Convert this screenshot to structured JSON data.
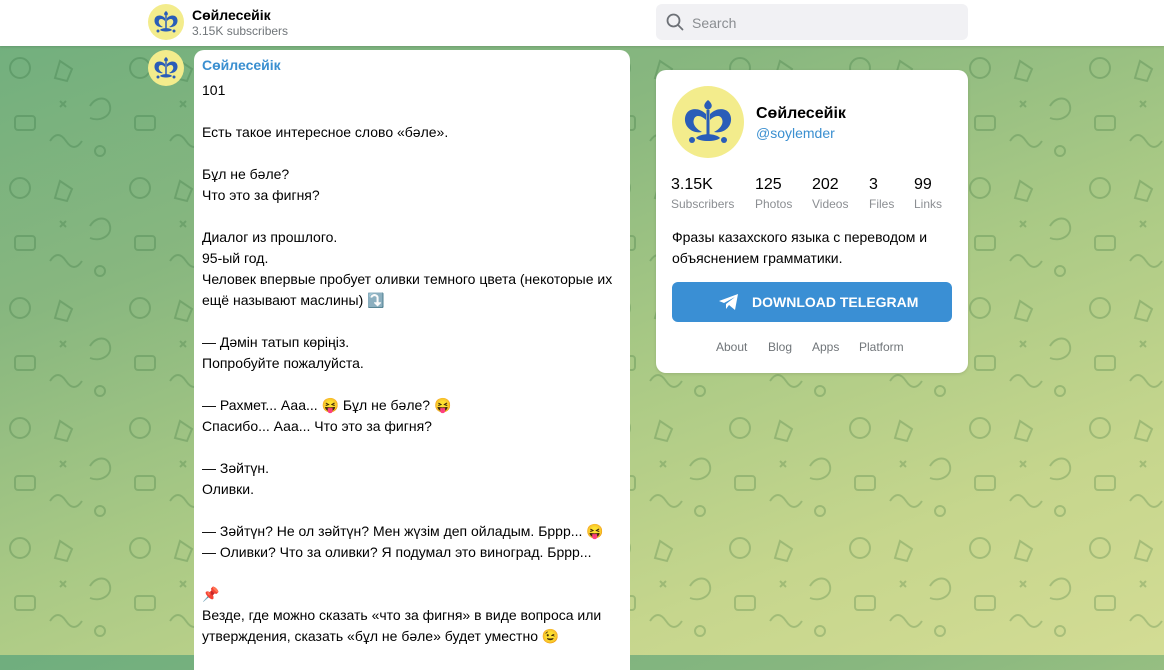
{
  "header": {
    "channel_name": "Сөйлесейік",
    "subscribers": "3.15K subscribers",
    "search_placeholder": "Search"
  },
  "post": {
    "author": "Сөйлесейік",
    "text": "101\n\nЕсть такое интересное слово «бәле».\n\nБұл не бәле?\nЧто это за фигня?\n\nДиалог из прошлого.\n95-ый год.\nЧеловек впервые пробует оливки темного цвета (некоторые их ещё называют маслины) ⤵️\n\n— Дәмін татып көріңіз.\nПопробуйте пожалуйста.\n\n— Рахмет... Ааа... 😝 Бұл не бәле? 😝\nСпасибо... Ааа... Что это за фигня?\n\n— Зәйтүн.\nОливки.\n\n— Зәйтүн? Не ол зәйтүн? Мен жүзім деп ойладым. Бррр... 😝\n— Оливки? Что за оливки? Я подумал это виноград. Бррр...\n\n📌\nВезде, где можно сказать «что за фигня» в виде вопроса или утверждения, сказать «бұл не бәле» будет уместно 😉"
  },
  "card": {
    "title": "Сөйлесейік",
    "handle": "@soylemder",
    "stats": [
      {
        "value": "3.15K",
        "label": "Subscribers"
      },
      {
        "value": "125",
        "label": "Photos"
      },
      {
        "value": "202",
        "label": "Videos"
      },
      {
        "value": "3",
        "label": "Files"
      },
      {
        "value": "99",
        "label": "Links"
      }
    ],
    "description": "Фразы казахского языка с переводом и объяснением грамматики.",
    "download_label": "DOWNLOAD TELEGRAM",
    "links": [
      "About",
      "Blog",
      "Apps",
      "Platform"
    ]
  },
  "colors": {
    "accent": "#3a8fd4",
    "link": "#3a8fd0",
    "avatar_bg": "#f3ec8c",
    "logo_blue": "#2a5db8"
  },
  "icons": {
    "search": "search-icon",
    "telegram": "telegram-plane-icon",
    "avatar": "channel-logo-icon"
  }
}
